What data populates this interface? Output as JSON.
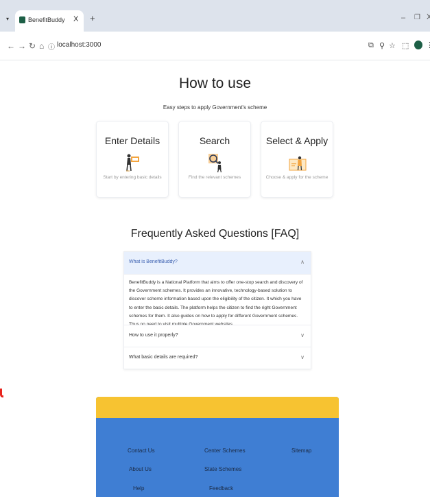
{
  "browser": {
    "tab_title": "BenefitBuddy",
    "tab_close": "X",
    "new_tab": "+",
    "url": "localhost:3000",
    "win_min": "–",
    "win_max": "❐",
    "win_close": "X"
  },
  "hero": {
    "title": "How to use",
    "subtitle": "Easy steps to apply Government's scheme"
  },
  "steps": [
    {
      "title": "Enter Details",
      "desc": "Start by entering basic details"
    },
    {
      "title": "Search",
      "desc": "Find the relevant schemes"
    },
    {
      "title": "Select & Apply",
      "desc": "Choose & apply for the scheme"
    }
  ],
  "faq": {
    "title": "Frequently Asked Questions [FAQ]",
    "items": [
      {
        "question": "What is BenefitBuddy?",
        "answer": "BenefitBuddy is a National Platform that aims to offer one-stop search and discovery of the Government schemes. It provides an innovative, technology-based solution to discover scheme information based upon the eligibility of the citizen. It which you have to enter the basic details. The platform helps the citizen to find the right Government schemes for them. It also guides on how to apply for different Government schemes. Thus no need to visit multiple Government websites."
      },
      {
        "question": "How to use it properly?"
      },
      {
        "question": "What basic details are required?"
      }
    ]
  },
  "footer": {
    "links": [
      "Contact Us",
      "Center Schemes",
      "Sitemap",
      "About Us",
      "State Schemes",
      "Help",
      "Feedback"
    ]
  },
  "colors": {
    "footer_band": "#f7c331",
    "footer_bg": "#3f7ed3",
    "faq_active_bg": "#e8f0fd",
    "brand_green": "#1d5f46"
  }
}
